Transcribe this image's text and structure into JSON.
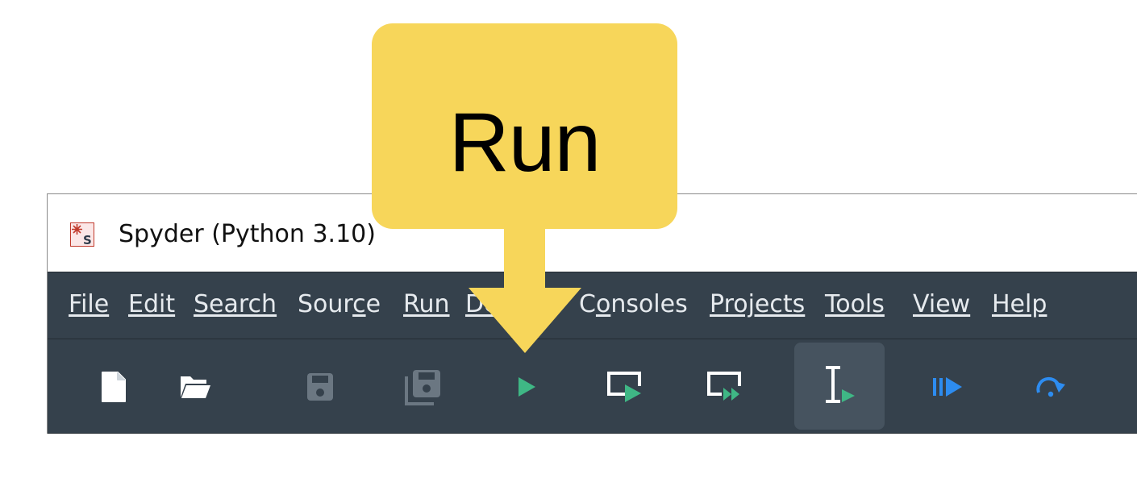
{
  "window": {
    "title": "Spyder (Python 3.10)",
    "app_icon": "spyder-logo-icon"
  },
  "menu": {
    "items": [
      {
        "label": "File",
        "mnemonic_index": 0
      },
      {
        "label": "Edit",
        "mnemonic_index": 0
      },
      {
        "label": "Search",
        "mnemonic_index": 0
      },
      {
        "label": "Source",
        "mnemonic_index": 4
      },
      {
        "label": "Run",
        "mnemonic_index": 0
      },
      {
        "label": "Debug",
        "mnemonic_index": 0
      },
      {
        "label": "Consoles",
        "mnemonic_index": 1
      },
      {
        "label": "Projects",
        "mnemonic_index": 0
      },
      {
        "label": "Tools",
        "mnemonic_index": 0
      },
      {
        "label": "View",
        "mnemonic_index": 0
      },
      {
        "label": "Help",
        "mnemonic_index": 0
      }
    ]
  },
  "toolbar": {
    "buttons": [
      {
        "name": "new-file",
        "icon": "new-file-icon",
        "enabled": true
      },
      {
        "name": "open-file",
        "icon": "open-folder-icon",
        "enabled": true
      },
      {
        "name": "save",
        "icon": "save-icon",
        "enabled": false
      },
      {
        "name": "save-all",
        "icon": "save-all-icon",
        "enabled": false
      },
      {
        "name": "run",
        "icon": "run-play-icon",
        "enabled": true
      },
      {
        "name": "run-cell",
        "icon": "run-cell-icon",
        "enabled": true
      },
      {
        "name": "run-cell-advance",
        "icon": "run-cell-advance-icon",
        "enabled": true
      },
      {
        "name": "run-selection",
        "icon": "run-selection-icon",
        "enabled": true,
        "active": true
      },
      {
        "name": "debug",
        "icon": "debug-icon",
        "enabled": true
      },
      {
        "name": "step",
        "icon": "step-over-icon",
        "enabled": true
      }
    ]
  },
  "callout": {
    "label": "Run",
    "icon": "arrow-down-icon"
  },
  "colors": {
    "menubar_bg": "#35414c",
    "menu_text": "#e6eaee",
    "callout": "#f7d65a",
    "run_green": "#3fb785",
    "debug_blue": "#2d8cf0",
    "disabled_icon": "#6b7782"
  }
}
